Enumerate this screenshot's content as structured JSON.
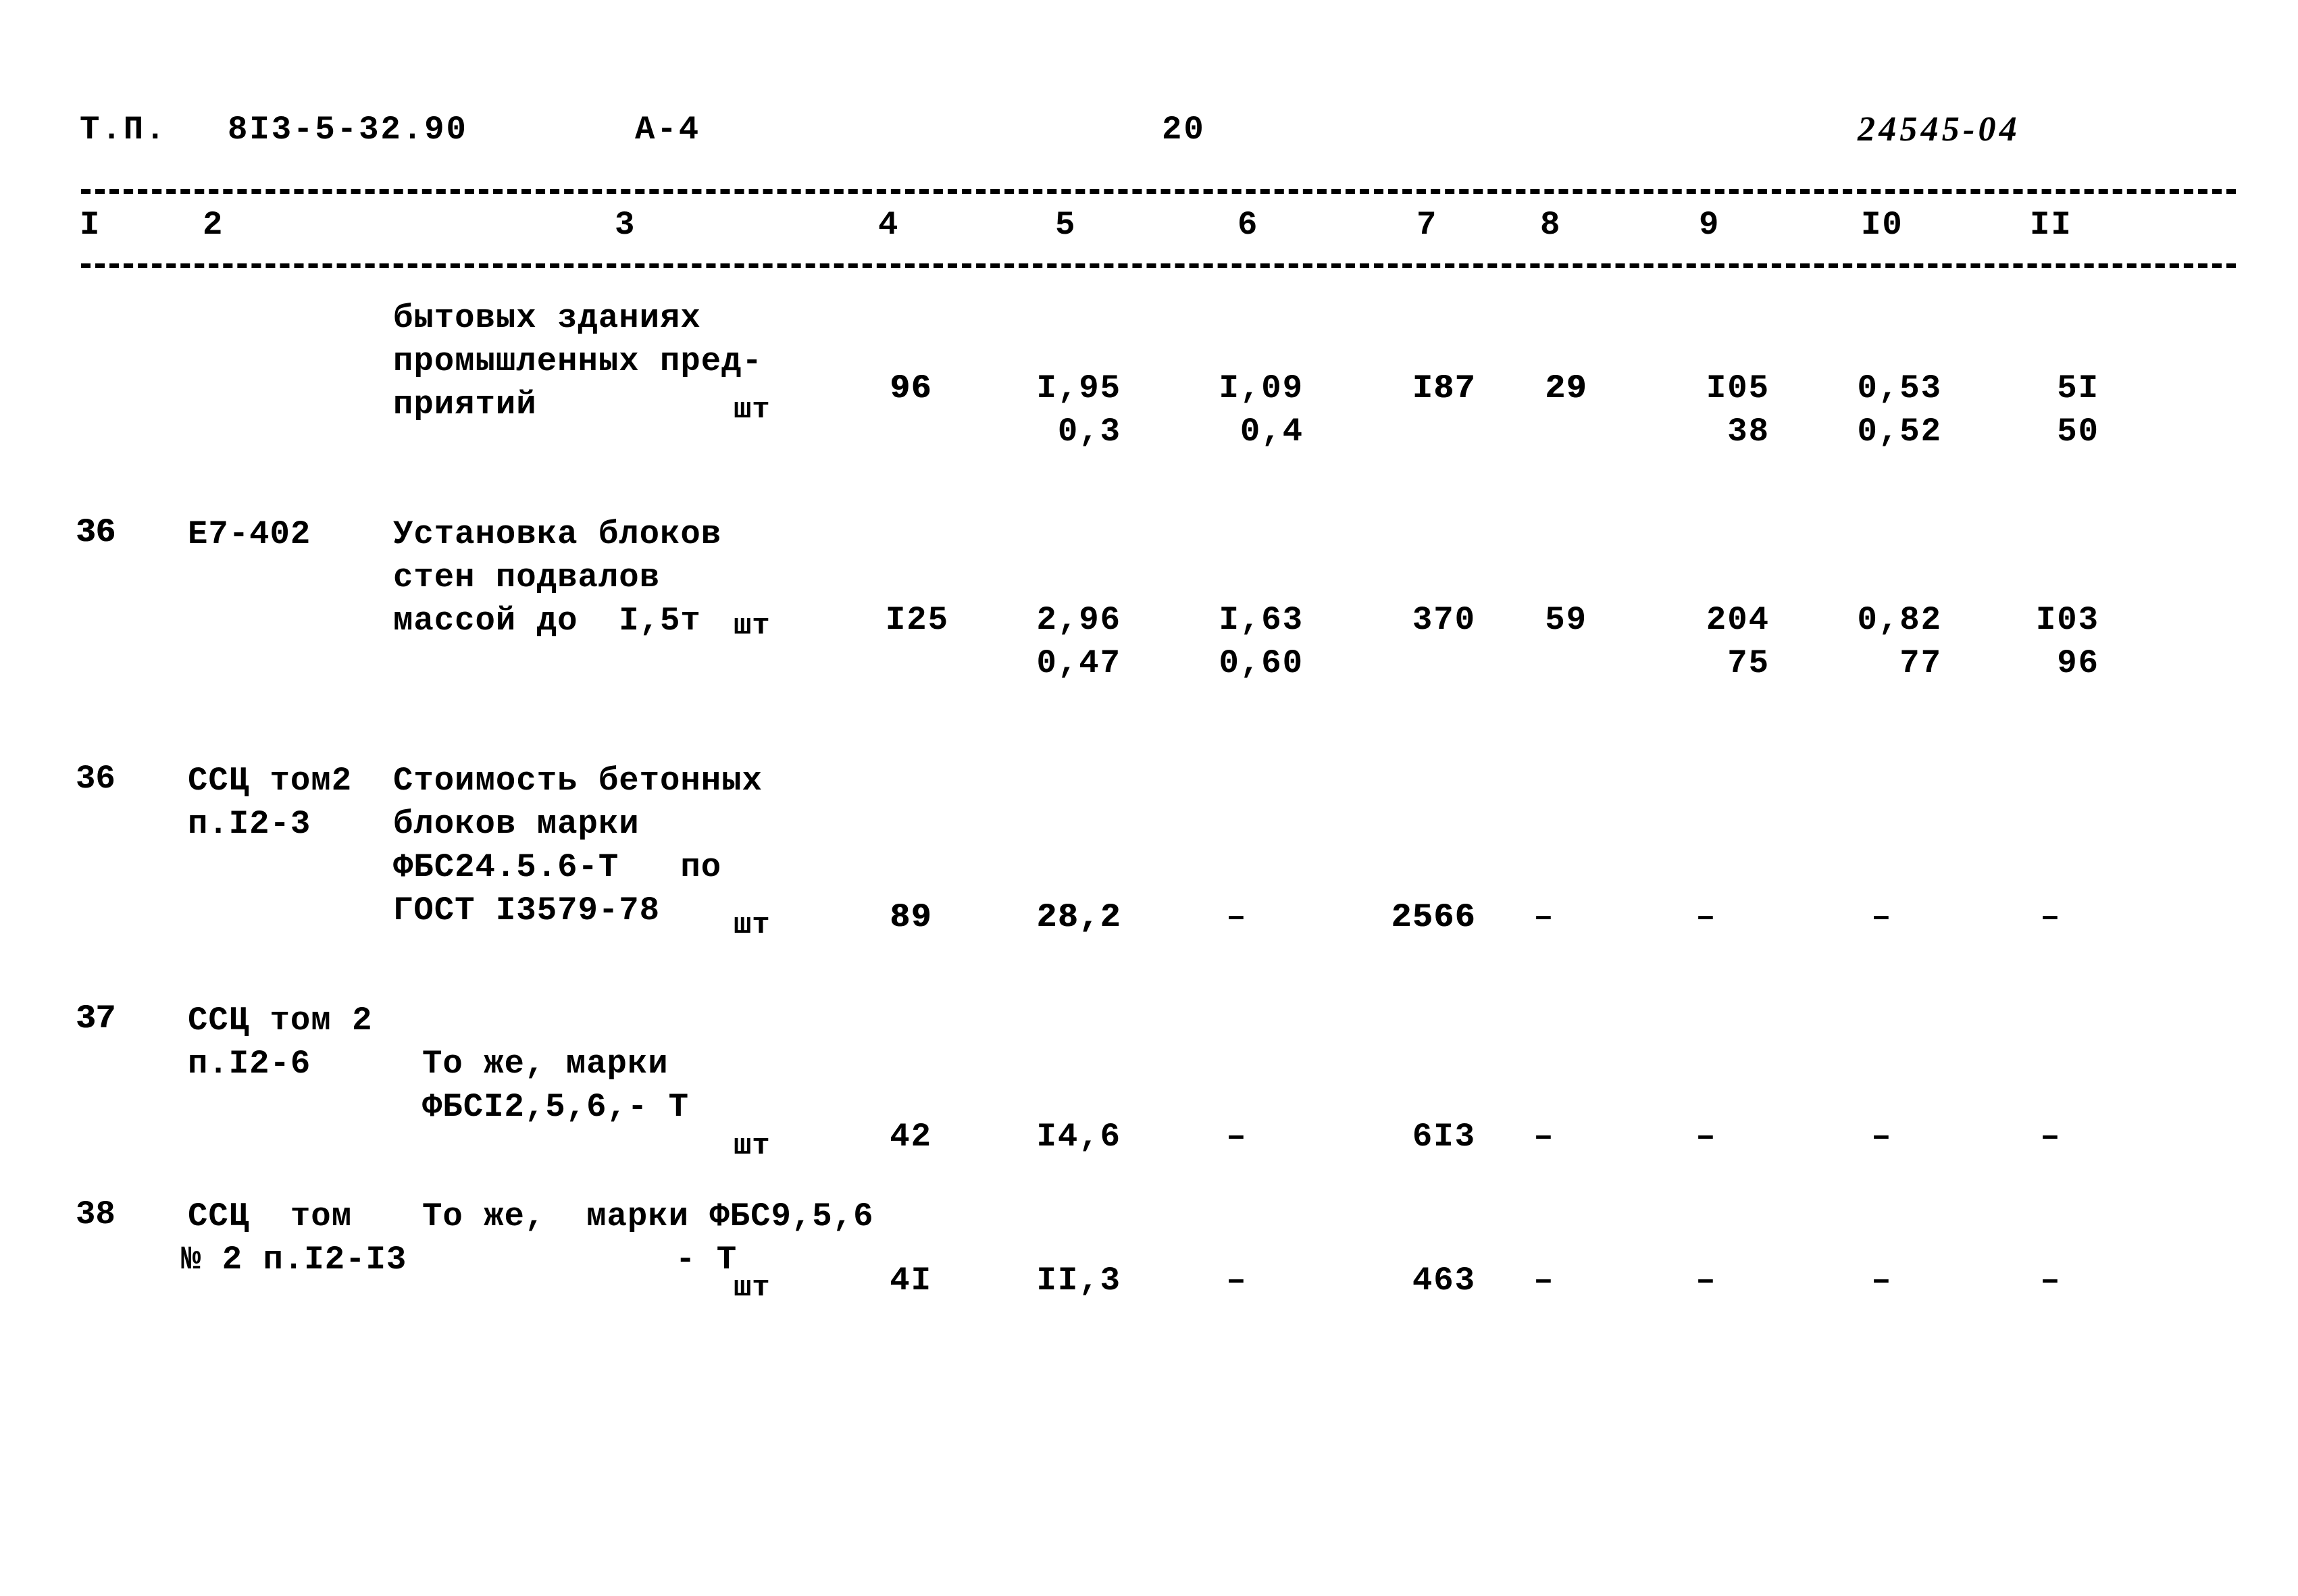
{
  "document": {
    "header": {
      "type_label": "Т.П.",
      "project_code": "8I3-5-32.90",
      "sheet_format": "А-4",
      "page_number": "20",
      "archive_stamp": "24545-04"
    },
    "column_headers": [
      "I",
      "2",
      "3",
      "4",
      "5",
      "6",
      "7",
      "8",
      "9",
      "I0",
      "II"
    ],
    "rows": [
      {
        "row_number": "",
        "norm_code": "",
        "description_lines": [
          "бытовых зданиях",
          "промышленных пред-",
          "приятий"
        ],
        "unit": "шт",
        "c4": "96",
        "c5_top": "I,95",
        "c5_bot": "0,3",
        "c6_top": "I,09",
        "c6_bot": "0,4",
        "c7": "I87",
        "c8": "29",
        "c9_top": "I05",
        "c9_bot": "38",
        "c10_top": "0,53",
        "c10_bot": "0,52",
        "c11_top": "5I",
        "c11_bot": "50"
      },
      {
        "row_number": "36",
        "norm_code_lines": [
          "Е7-402"
        ],
        "description_lines": [
          "Установка блоков",
          "стен подвалов",
          "массой до  I,5т"
        ],
        "unit": "шт",
        "c4": "I25",
        "c5_top": "2,96",
        "c5_bot": "0,47",
        "c6_top": "I,63",
        "c6_bot": "0,60",
        "c7": "370",
        "c8": "59",
        "c9_top": "204",
        "c9_bot": "75",
        "c10_top": "0,82",
        "c10_bot": "77",
        "c11_top": "I03",
        "c11_bot": "96"
      },
      {
        "row_number": "36",
        "norm_code_lines": [
          "ССЦ том2",
          "п.I2-3"
        ],
        "description_lines": [
          "Стоимость бетонных",
          "блоков марки",
          "ФБС24.5.6-Т   по",
          "ГОСТ I3579-78"
        ],
        "unit": "шт",
        "c4": "89",
        "c5_top": "28,2",
        "c6_top": "–",
        "c7": "2566",
        "c8": "–",
        "c9_top": "–",
        "c10_top": "–",
        "c11_top": "–"
      },
      {
        "row_number": "37",
        "norm_code_lines": [
          "ССЦ том 2",
          "п.I2-6"
        ],
        "description_lines": [
          "То же, марки",
          "ФБСI2,5,6,- Т"
        ],
        "unit": "шт",
        "c4": "42",
        "c5_top": "I4,6",
        "c6_top": "–",
        "c7": "6I3",
        "c8": "–",
        "c9_top": "–",
        "c10_top": "–",
        "c11_top": "–"
      },
      {
        "row_number": "38",
        "norm_code_lines": [
          "ССЦ  том",
          "№ 2 п.I2-I3"
        ],
        "description_lines": [
          "То же,  марки ФБС9,5,6",
          "- Т"
        ],
        "unit": "шт",
        "c4": "4I",
        "c5_top": "II,3",
        "c6_top": "–",
        "c7": "463",
        "c8": "–",
        "c9_top": "–",
        "c10_top": "–",
        "c11_top": "–"
      }
    ]
  }
}
